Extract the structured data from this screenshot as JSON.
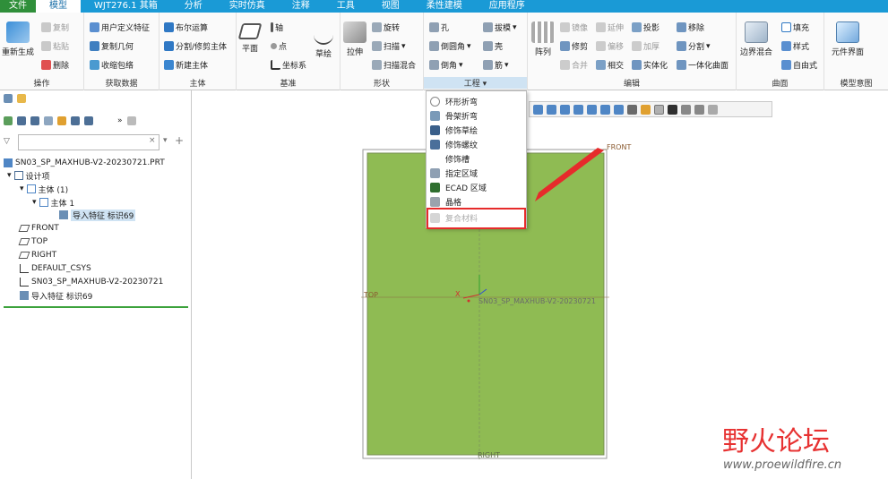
{
  "menu_tabs": [
    "文件",
    "模型",
    "WJT276.1 其箱",
    "分析",
    "实时仿真",
    "注释",
    "工具",
    "视图",
    "柔性建模",
    "应用程序"
  ],
  "ribbon": {
    "operations": {
      "label": "操作",
      "regenerate": "重新生成",
      "copy": "复制",
      "paste": "粘贴",
      "delete": "删除"
    },
    "get_data": {
      "label": "获取数据",
      "udf": "用户定义特征",
      "copy_geometry": "复制几何",
      "shrinkwrap": "收缩包络"
    },
    "body": {
      "label": "主体",
      "boolean": "布尔运算",
      "split_trim": "分割/修剪主体",
      "new_body": "新建主体"
    },
    "datum": {
      "label": "基准",
      "plane": "平面",
      "axis": "轴",
      "point": "点",
      "csys": "坐标系",
      "sketch": "草绘"
    },
    "shapes": {
      "label": "形状",
      "extrude": "拉伸",
      "revolve": "旋转",
      "sweep": "扫描",
      "swept_blend": "扫描混合"
    },
    "engineering": {
      "label": "工程",
      "hole": "孔",
      "round": "倒圆角",
      "chamfer": "倒角",
      "draft": "拔模",
      "shell": "壳",
      "rib": "筋"
    },
    "editing": {
      "label": "编辑",
      "pattern": "阵列",
      "mirror": "镜像",
      "extend": "延伸",
      "project": "投影",
      "remove": "移除",
      "trim": "修剪",
      "offset": "偏移",
      "thicken": "加厚",
      "split": "分割",
      "merge": "合并",
      "intersect": "相交",
      "solidify": "实体化",
      "unify_surfaces": "一体化曲面"
    },
    "surfaces": {
      "label": "曲面",
      "boundary_blend": "边界混合",
      "fill": "填充",
      "style": "样式",
      "freeform": "自由式"
    },
    "model_intent": {
      "label": "模型意图",
      "component_interface": "元件界面"
    }
  },
  "dropdown": {
    "items": [
      "环形折弯",
      "骨架折弯",
      "修饰草绘",
      "修饰螺纹",
      "修饰槽",
      "指定区域",
      "ECAD 区域",
      "晶格",
      "复合材料"
    ]
  },
  "tree": {
    "root": "SN03_SP_MAXHUB-V2-20230721.PRT",
    "design_items": "设计项",
    "bodies": "主体 (1)",
    "body1": "主体 1",
    "import_feature_selected": "导入特征 标识69",
    "front": "FRONT",
    "top": "TOP",
    "right": "RIGHT",
    "csys": "DEFAULT_CSYS",
    "csys_part": "SN03_SP_MAXHUB-V2-20230721",
    "import_feature": "导入特征 标识69"
  },
  "graphics": {
    "front_label": "FRONT",
    "top_label": "TOP",
    "right_label": "RIGHT",
    "csys_label": "SN03_SP_MAXHUB-V2-20230721",
    "x_label": "X"
  },
  "watermark": {
    "name": "野火论坛",
    "url": "www.proewildfire.cn"
  },
  "colors": {
    "menu_bar": "#1a9ad6",
    "file_tab": "#2f8f3a",
    "part": "#8fbb53",
    "part_border": "#7a8f55",
    "highlight_box": "#e62b2b",
    "arrow": "#e62b2b",
    "watermark": "#e73232"
  }
}
